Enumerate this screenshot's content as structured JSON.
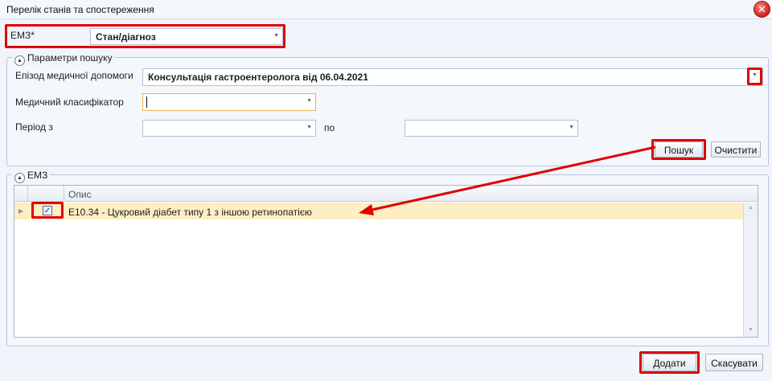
{
  "window": {
    "title": "Перелік станів та спостереження"
  },
  "icons": {
    "close": "close-icon",
    "collapse": "chevron-up-icon",
    "dropdown": "dropdown-arrow-icon",
    "checkmark": "checkmark-icon"
  },
  "emz": {
    "label": "ЕМЗ*",
    "value": "Стан/діагноз"
  },
  "search_params": {
    "group_title": "Параметри пошуку",
    "episode": {
      "label": "Епізод медичної допомоги",
      "value": "Консультація гастроентеролога від 06.04.2021"
    },
    "classifier": {
      "label": "Медичний класифікатор",
      "value": ""
    },
    "period": {
      "label": "Період з",
      "from": "",
      "to_label": "по",
      "to": ""
    },
    "search_button": "Пошук",
    "clear_button": "Очистити"
  },
  "emz_group": {
    "title": "ЕМЗ",
    "columns": [
      "Опис"
    ],
    "rows": [
      {
        "checked": true,
        "description": "E10.34 - Цукровий діабет типу 1 з іншою ретинопатією"
      }
    ]
  },
  "footer": {
    "add_button": "Додати",
    "cancel_button": "Скасувати"
  },
  "annotation_color": "#e00000"
}
